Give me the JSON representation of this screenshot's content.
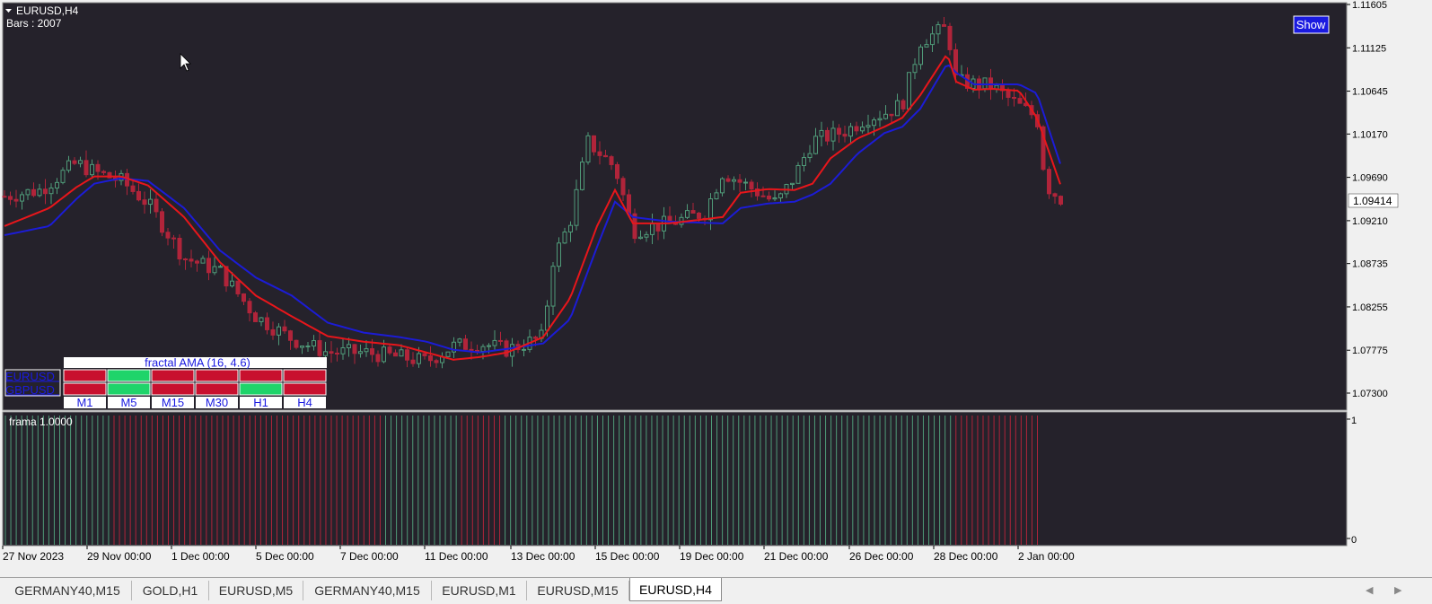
{
  "symbol_title": "EURUSD,H4",
  "bars_label": "Bars : 2007",
  "show_button": "Show",
  "current_price": "1.09414",
  "price_axis": [
    "1.11605",
    "1.11125",
    "1.10645",
    "1.10170",
    "1.09690",
    "1.09210",
    "1.08735",
    "1.08255",
    "1.07775",
    "1.07300"
  ],
  "time_axis": [
    "27 Nov 2023",
    "29 Nov 00:00",
    "1 Dec 00:00",
    "5 Dec 00:00",
    "7 Dec 00:00",
    "11 Dec 00:00",
    "13 Dec 00:00",
    "15 Dec 00:00",
    "19 Dec 00:00",
    "21 Dec 00:00",
    "26 Dec 00:00",
    "28 Dec 00:00",
    "2 Jan 00:00"
  ],
  "indicator_label": "frama  1.0000",
  "indicator_axis": [
    "1",
    "0"
  ],
  "dashboard": {
    "title": "fractal AMA (16, 4.6)",
    "rows": [
      {
        "symbol": "EURUSD",
        "states": [
          "red",
          "green",
          "red",
          "red",
          "red",
          "red"
        ]
      },
      {
        "symbol": "GBPUSD",
        "states": [
          "red",
          "green",
          "red",
          "red",
          "green",
          "red"
        ]
      }
    ],
    "timeframes": [
      "M1",
      "M5",
      "M15",
      "M30",
      "H1",
      "H4"
    ]
  },
  "tabs": [
    {
      "label": "GERMANY40,M15",
      "active": false
    },
    {
      "label": "GOLD,H1",
      "active": false
    },
    {
      "label": "EURUSD,M5",
      "active": false
    },
    {
      "label": "GERMANY40,M15",
      "active": false
    },
    {
      "label": "EURUSD,M1",
      "active": false
    },
    {
      "label": "EURUSD,M15",
      "active": false
    },
    {
      "label": "EURUSD,H4",
      "active": true
    }
  ],
  "colors": {
    "background": "#25222b",
    "bull_candle": "#4f9a78",
    "bear_candle": "#b0243a",
    "fast_line": "#e8161b",
    "slow_line": "#1c1cd6",
    "dash_red": "#c8102e",
    "dash_green": "#1fd46a"
  },
  "chart_data": {
    "type": "candlestick",
    "timeframe": "H4",
    "y_range": [
      1.07,
      1.11605
    ],
    "close_path": [
      [
        0,
        1.0948
      ],
      [
        0.04,
        1.0955
      ],
      [
        0.08,
        1.0985
      ],
      [
        0.1,
        1.0975
      ],
      [
        0.13,
        1.0965
      ],
      [
        0.16,
        1.094
      ],
      [
        0.2,
        1.088
      ],
      [
        0.24,
        1.0865
      ],
      [
        0.28,
        1.0815
      ],
      [
        0.32,
        1.079
      ],
      [
        0.36,
        1.0775
      ],
      [
        0.4,
        1.0775
      ],
      [
        0.44,
        1.077
      ],
      [
        0.47,
        1.0765
      ],
      [
        0.5,
        1.0782
      ],
      [
        0.53,
        1.0785
      ],
      [
        0.56,
        1.0778
      ],
      [
        0.6,
        1.0792
      ],
      [
        0.61,
        1.0875
      ],
      [
        0.63,
        1.092
      ],
      [
        0.65,
        1.1008
      ],
      [
        0.68,
        1.098
      ],
      [
        0.7,
        1.091
      ],
      [
        0.74,
        1.0918
      ],
      [
        0.78,
        1.093
      ],
      [
        0.8,
        1.0975
      ],
      [
        0.83,
        1.0958
      ],
      [
        0.86,
        1.094
      ],
      [
        0.88,
        1.097
      ],
      [
        0.9,
        1.101
      ],
      [
        0.92,
        1.1015
      ],
      [
        0.94,
        1.1022
      ],
      [
        0.96,
        1.1035
      ],
      [
        0.98,
        1.104
      ],
      [
        1,
        1.105
      ],
      [
        1.02,
        1.112
      ],
      [
        1.05,
        1.1135
      ],
      [
        1.06,
        1.1075
      ],
      [
        1.1,
        1.107
      ],
      [
        1.12,
        1.1055
      ],
      [
        1.15,
        1.1035
      ],
      [
        1.16,
        1.096
      ],
      [
        1.18,
        1.0942
      ]
    ],
    "fast_ma": [
      [
        0,
        1.0915
      ],
      [
        0.05,
        1.0935
      ],
      [
        0.08,
        1.0958
      ],
      [
        0.1,
        1.097
      ],
      [
        0.13,
        1.097
      ],
      [
        0.16,
        1.096
      ],
      [
        0.2,
        1.0925
      ],
      [
        0.24,
        1.0875
      ],
      [
        0.28,
        1.0838
      ],
      [
        0.32,
        1.0815
      ],
      [
        0.36,
        1.0793
      ],
      [
        0.4,
        1.0787
      ],
      [
        0.44,
        1.0783
      ],
      [
        0.47,
        1.0775
      ],
      [
        0.5,
        1.0767
      ],
      [
        0.53,
        1.077
      ],
      [
        0.56,
        1.0775
      ],
      [
        0.6,
        1.0792
      ],
      [
        0.63,
        1.0835
      ],
      [
        0.66,
        1.0915
      ],
      [
        0.68,
        1.0955
      ],
      [
        0.7,
        1.0918
      ],
      [
        0.74,
        1.0918
      ],
      [
        0.8,
        1.0925
      ],
      [
        0.82,
        1.0952
      ],
      [
        0.85,
        1.0956
      ],
      [
        0.88,
        1.0955
      ],
      [
        0.9,
        1.0962
      ],
      [
        0.92,
        1.099
      ],
      [
        0.95,
        1.1012
      ],
      [
        0.98,
        1.1025
      ],
      [
        1.0,
        1.1035
      ],
      [
        1.02,
        1.106
      ],
      [
        1.05,
        1.1106
      ],
      [
        1.06,
        1.1075
      ],
      [
        1.08,
        1.1066
      ],
      [
        1.1,
        1.1067
      ],
      [
        1.13,
        1.1065
      ],
      [
        1.15,
        1.1035
      ],
      [
        1.18,
        1.095
      ]
    ],
    "slow_ma": [
      [
        0,
        1.0905
      ],
      [
        0.05,
        1.0915
      ],
      [
        0.08,
        1.0945
      ],
      [
        0.1,
        1.0962
      ],
      [
        0.13,
        1.0968
      ],
      [
        0.16,
        1.0965
      ],
      [
        0.2,
        1.0935
      ],
      [
        0.24,
        1.0888
      ],
      [
        0.28,
        1.0858
      ],
      [
        0.32,
        1.0838
      ],
      [
        0.36,
        1.0808
      ],
      [
        0.4,
        1.0797
      ],
      [
        0.44,
        1.0792
      ],
      [
        0.47,
        1.0787
      ],
      [
        0.5,
        1.0778
      ],
      [
        0.53,
        1.0775
      ],
      [
        0.56,
        1.0779
      ],
      [
        0.6,
        1.0785
      ],
      [
        0.63,
        1.0812
      ],
      [
        0.66,
        1.0892
      ],
      [
        0.68,
        1.0942
      ],
      [
        0.7,
        1.0925
      ],
      [
        0.74,
        1.092
      ],
      [
        0.8,
        1.0918
      ],
      [
        0.82,
        1.0935
      ],
      [
        0.85,
        1.094
      ],
      [
        0.88,
        1.0942
      ],
      [
        0.9,
        1.095
      ],
      [
        0.92,
        1.0962
      ],
      [
        0.95,
        1.0995
      ],
      [
        0.98,
        1.1018
      ],
      [
        1.0,
        1.1025
      ],
      [
        1.02,
        1.1045
      ],
      [
        1.05,
        1.1095
      ],
      [
        1.06,
        1.1085
      ],
      [
        1.08,
        1.1072
      ],
      [
        1.1,
        1.1072
      ],
      [
        1.13,
        1.1072
      ],
      [
        1.15,
        1.1062
      ],
      [
        1.18,
        1.0972
      ]
    ],
    "frama_state_runs": [
      {
        "state": "up",
        "bars": 20
      },
      {
        "state": "down",
        "bars": 50
      },
      {
        "state": "up",
        "bars": 14
      },
      {
        "state": "down",
        "bars": 8
      },
      {
        "state": "up",
        "bars": 83
      },
      {
        "state": "down",
        "bars": 16
      }
    ],
    "indicator_range": [
      0,
      1
    ]
  }
}
